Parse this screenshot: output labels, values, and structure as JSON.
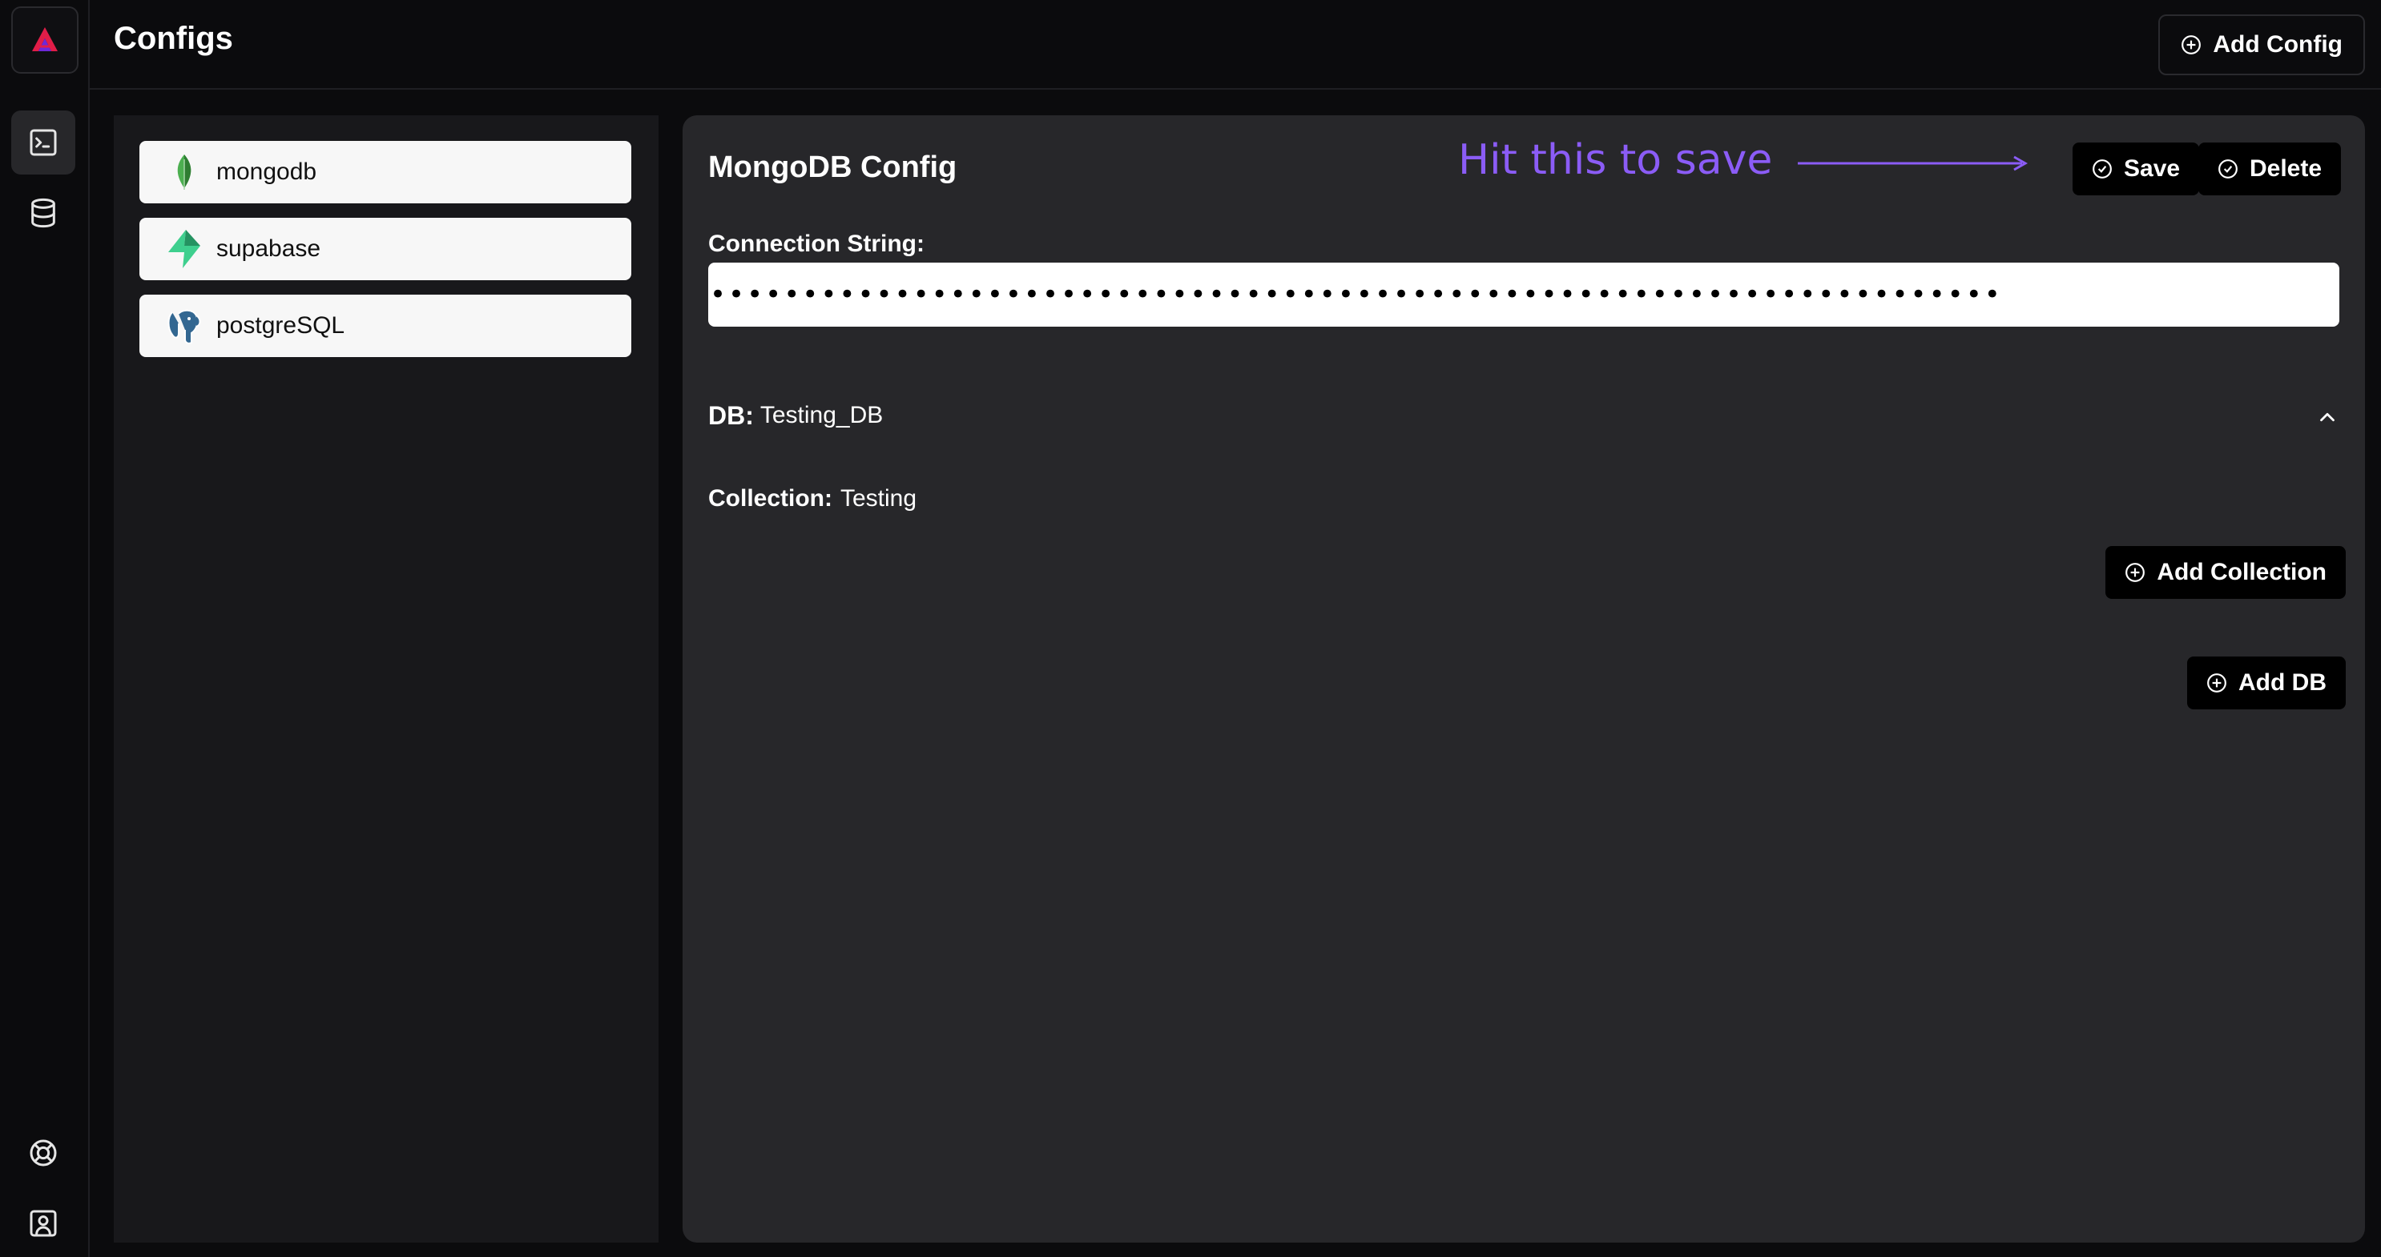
{
  "header": {
    "title": "Configs",
    "add_config_label": "Add Config"
  },
  "rail": {
    "items": [
      {
        "icon": "terminal-icon",
        "active": true
      },
      {
        "icon": "database-icon",
        "active": false
      }
    ],
    "bottom": [
      {
        "icon": "help-lifebuoy-icon"
      },
      {
        "icon": "user-profile-icon"
      }
    ]
  },
  "configs": [
    {
      "label": "mongodb",
      "icon": "mongodb-leaf-icon"
    },
    {
      "label": "supabase",
      "icon": "supabase-bolt-icon"
    },
    {
      "label": "postgreSQL",
      "icon": "postgresql-elephant-icon"
    }
  ],
  "editor": {
    "title": "MongoDB Config",
    "annotation": "Hit this to save",
    "save_label": "Save",
    "delete_label": "Delete",
    "connection_label": "Connection String:",
    "connection_value": "••••••••••••••••••••••••••••••••••••••••••••••••••••••••••••••••••••••",
    "db_key": "DB:",
    "db_value": "Testing_DB",
    "collection_key": "Collection:",
    "collection_value": "Testing",
    "add_collection_label": "Add Collection",
    "add_db_label": "Add DB"
  },
  "colors": {
    "accent_annotation": "#8b5cf6",
    "background": "#0b0b0d",
    "panel": "#27272a",
    "list_panel": "#18181b"
  }
}
